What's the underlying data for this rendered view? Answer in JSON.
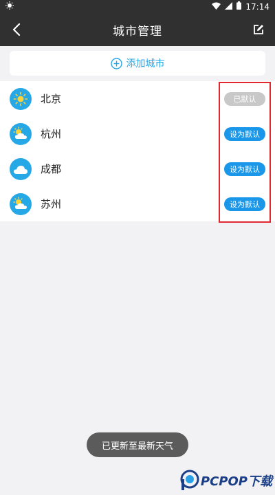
{
  "statusbar": {
    "time": "17:14"
  },
  "header": {
    "title": "城市管理"
  },
  "add_city": {
    "label": "添加城市"
  },
  "cities": [
    {
      "name": "北京",
      "icon": "sun-icon",
      "button": "已默认",
      "is_default": true
    },
    {
      "name": "杭州",
      "icon": "partly-cloudy-icon",
      "button": "设为默认",
      "is_default": false
    },
    {
      "name": "成都",
      "icon": "cloud-icon",
      "button": "设为默认",
      "is_default": false
    },
    {
      "name": "苏州",
      "icon": "partly-cloudy-icon",
      "button": "设为默认",
      "is_default": false
    }
  ],
  "toast": {
    "text": "已更新至最新天气"
  },
  "watermark": {
    "text": "PCPOP下载"
  },
  "colors": {
    "accent": "#1a97e8",
    "header": "#303030",
    "highlight": "#e0282e",
    "disabled": "#c8c8c8"
  }
}
